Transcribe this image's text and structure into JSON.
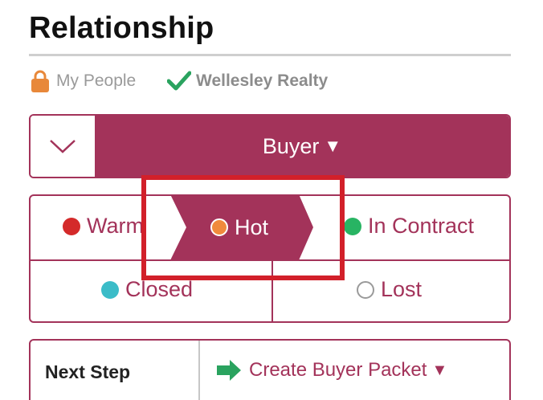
{
  "header": {
    "title": "Relationship"
  },
  "meta": {
    "people_label": "My People",
    "agency_label": "Wellesley Realty"
  },
  "type_bar": {
    "selected": "Buyer",
    "caret": "▼"
  },
  "statuses": {
    "warm": {
      "label": "Warm",
      "color": "#d42a2a"
    },
    "hot": {
      "label": "Hot",
      "color": "#f08a3c",
      "selected": true
    },
    "in_contract": {
      "label": "In Contract",
      "color": "#28b463"
    },
    "closed": {
      "label": "Closed",
      "color": "#3bbcc8"
    },
    "lost": {
      "label": "Lost",
      "color": "#ffffff"
    }
  },
  "next_step": {
    "label": "Next Step",
    "action": "Create Buyer Packet",
    "caret": "▼"
  },
  "colors": {
    "accent": "#a3335a",
    "highlight": "#d2202a"
  }
}
